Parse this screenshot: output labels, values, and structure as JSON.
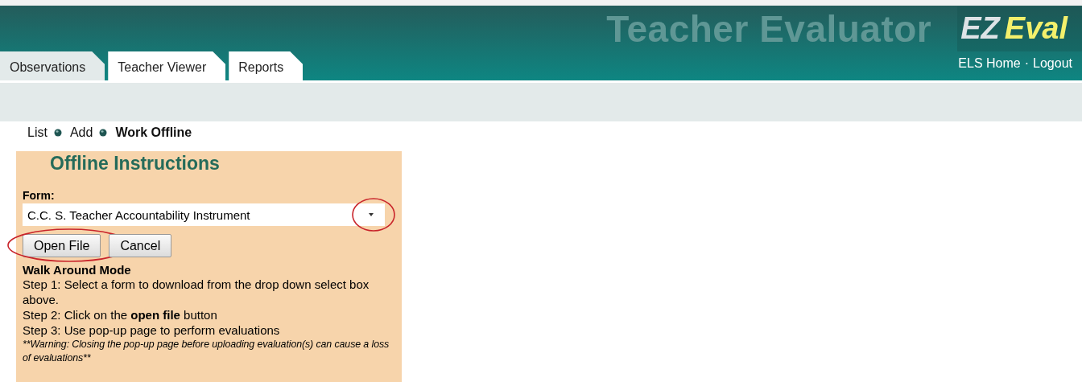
{
  "header": {
    "title": "Teacher Evaluator",
    "logo": {
      "part_1": "EZ",
      "part_2": "Eval"
    },
    "links": [
      "ELS Home",
      "Logout"
    ],
    "separator": "·"
  },
  "tabs": [
    {
      "label": "Observations",
      "selected": true
    },
    {
      "label": "Teacher Viewer",
      "selected": false
    },
    {
      "label": "Reports",
      "selected": false
    }
  ],
  "breadcrumb": [
    {
      "label": "List",
      "selected": false
    },
    {
      "label": "Add",
      "selected": false
    },
    {
      "label": "Work Offline",
      "selected": true
    }
  ],
  "panel": {
    "title": "Offline Instructions",
    "form_label": "Form:",
    "select": {
      "value": "C.C. S. Teacher Accountability Instrument",
      "circled": true
    },
    "buttons": [
      {
        "label": "Open File",
        "circled": true
      },
      {
        "label": "Cancel",
        "circled": false
      }
    ],
    "mode_title": "Walk Around Mode",
    "steps": [
      "Step 1: Select a form to download from the drop down select box above.",
      "Step 2: Click on the **open file** button",
      "Step 3: Use pop-up page to perform evaluations"
    ],
    "warning": "**Warning: Closing the pop-up page before uploading evaluation(s) can cause a loss of evaluations**"
  }
}
